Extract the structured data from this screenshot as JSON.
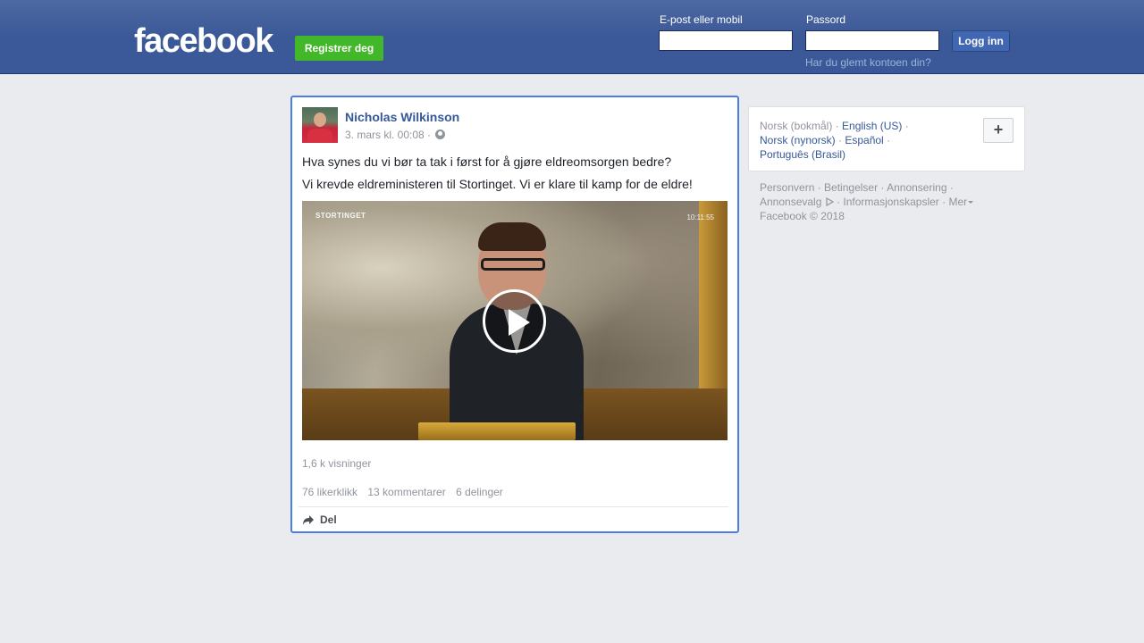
{
  "header": {
    "logo": "facebook",
    "register_label": "Registrer deg",
    "email_label": "E-post eller mobil",
    "password_label": "Passord",
    "login_label": "Logg inn",
    "forgot_label": "Har du glemt kontoen din?"
  },
  "post": {
    "author": "Nicholas Wilkinson",
    "timestamp": "3. mars kl. 00:08 ·",
    "text_line1": "Hva synes du vi bør ta tak i først for å gjøre eldreomsorgen bedre?",
    "text_line2": "Vi krevde eldreministeren til Stortinget. Vi er klare til kamp for de eldre!",
    "video_channel": "STORTINGET",
    "video_clock": "10:11:55",
    "views": "1,6 k visninger",
    "likes": "76 likerklikk",
    "comments": "13 kommentarer",
    "shares": "6 delinger",
    "share_label": "Del"
  },
  "languages": {
    "current": "Norsk (bokmål)",
    "items": [
      "English (US)",
      "Norsk (nynorsk)",
      "Español",
      "Português (Brasil)"
    ],
    "add_label": "+"
  },
  "footer": {
    "links": [
      "Personvern",
      "Betingelser",
      "Annonsering",
      "Annonsevalg",
      "Informasjonskapsler",
      "Mer"
    ],
    "copyright": "Facebook © 2018"
  }
}
